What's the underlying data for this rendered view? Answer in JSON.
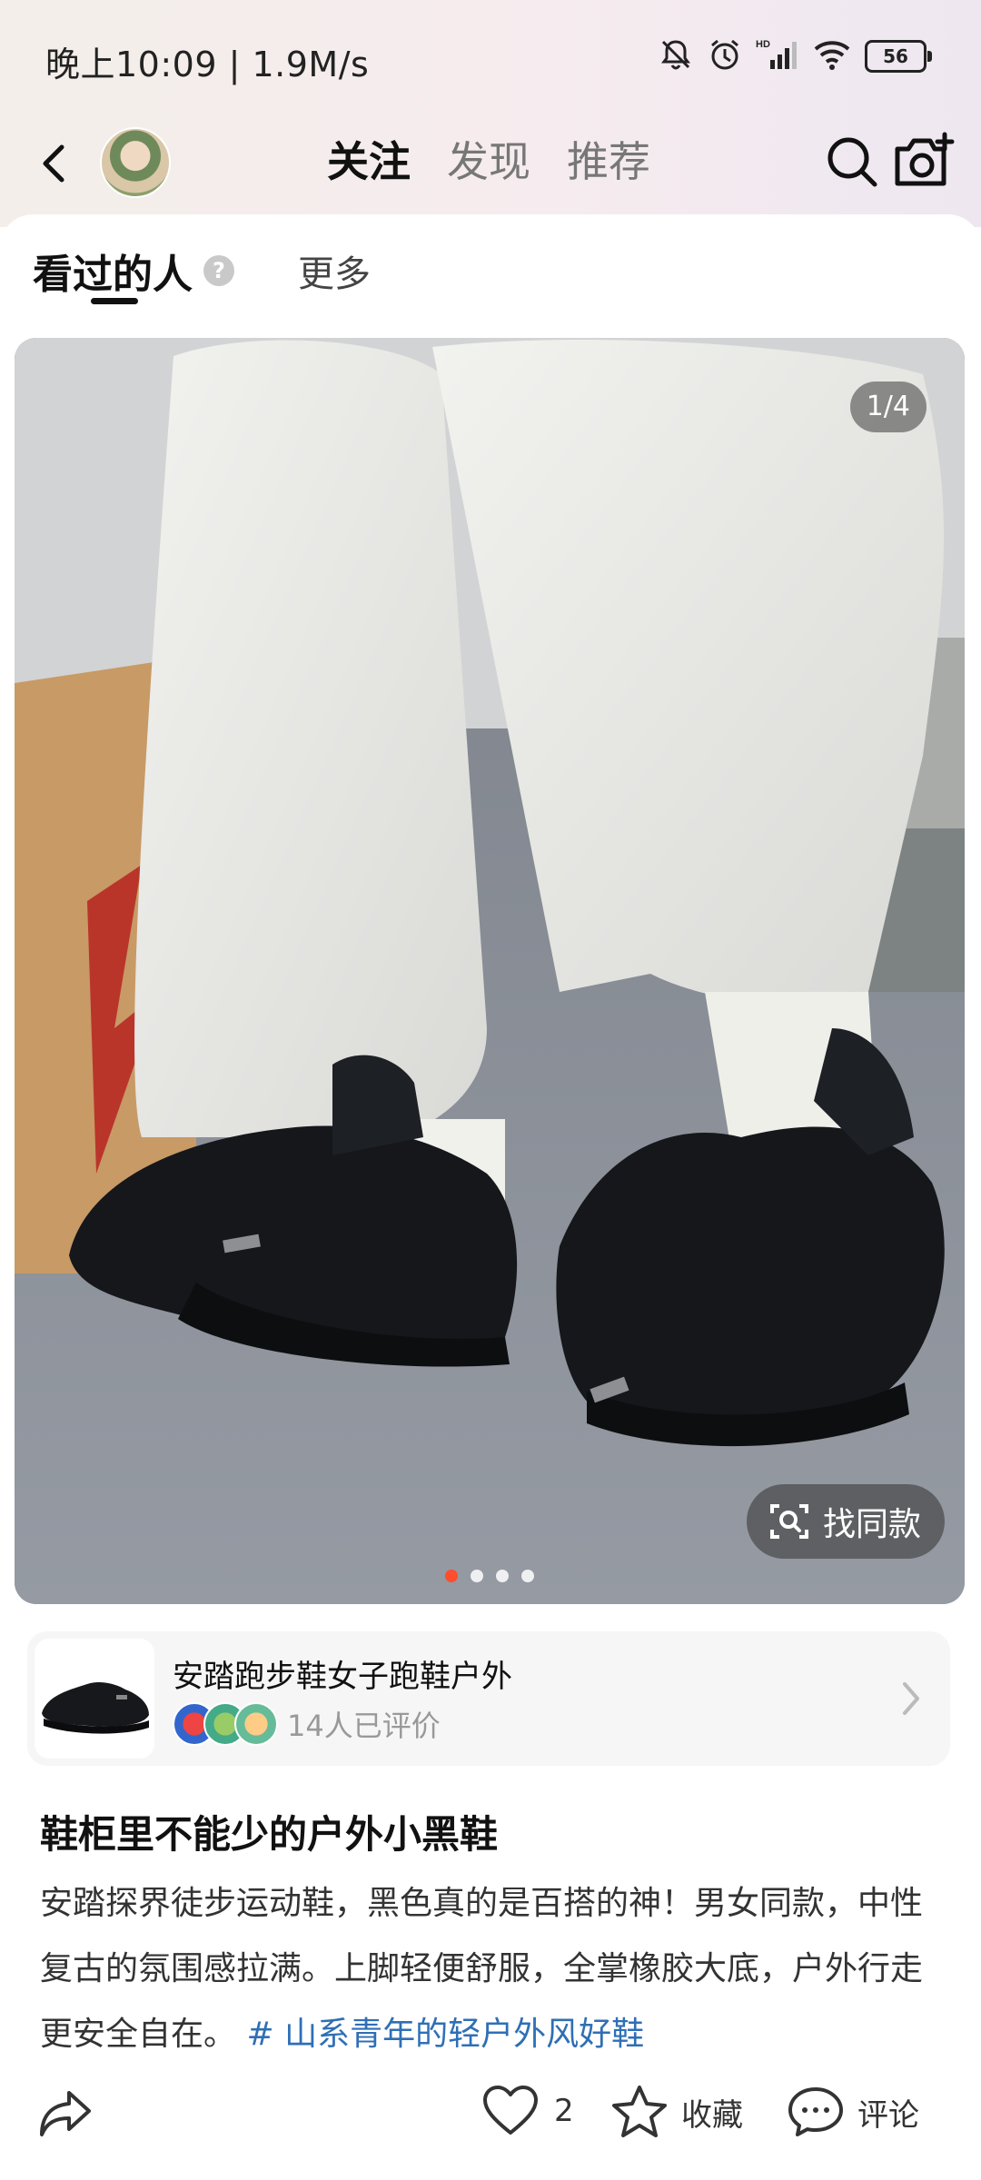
{
  "status_bar": {
    "time_speed": "晚上10:09 | 1.9M/s",
    "battery": "56",
    "network_label": "HD"
  },
  "nav": {
    "tabs": [
      {
        "label": "关注",
        "active": true
      },
      {
        "label": "发现",
        "active": false
      },
      {
        "label": "推荐",
        "active": false
      }
    ]
  },
  "subtabs": {
    "main": "看过的人",
    "help": "?",
    "more": "更多"
  },
  "photo": {
    "page_indicator": "1/4",
    "find_same_label": "找同款",
    "dots_total": 4,
    "dots_active": 1
  },
  "product": {
    "title": "安踏跑步鞋女子跑鞋户外",
    "reviews": "14人已评价"
  },
  "post": {
    "title": "鞋柜里不能少的户外小黑鞋",
    "body": "安踏探界徒步运动鞋，黑色真的是百搭的神！男女同款，中性复古的氛围感拉满。上脚轻便舒服，全掌橡胶大底，户外行走更安全自在。",
    "hashtag": "# 山系青年的轻户外风好鞋"
  },
  "actions": {
    "likes": "2",
    "favorite_label": "收藏",
    "comment_label": "评论"
  },
  "colors": {
    "accent_dot": "#ff4d2e",
    "hashtag": "#2f6fb5"
  }
}
